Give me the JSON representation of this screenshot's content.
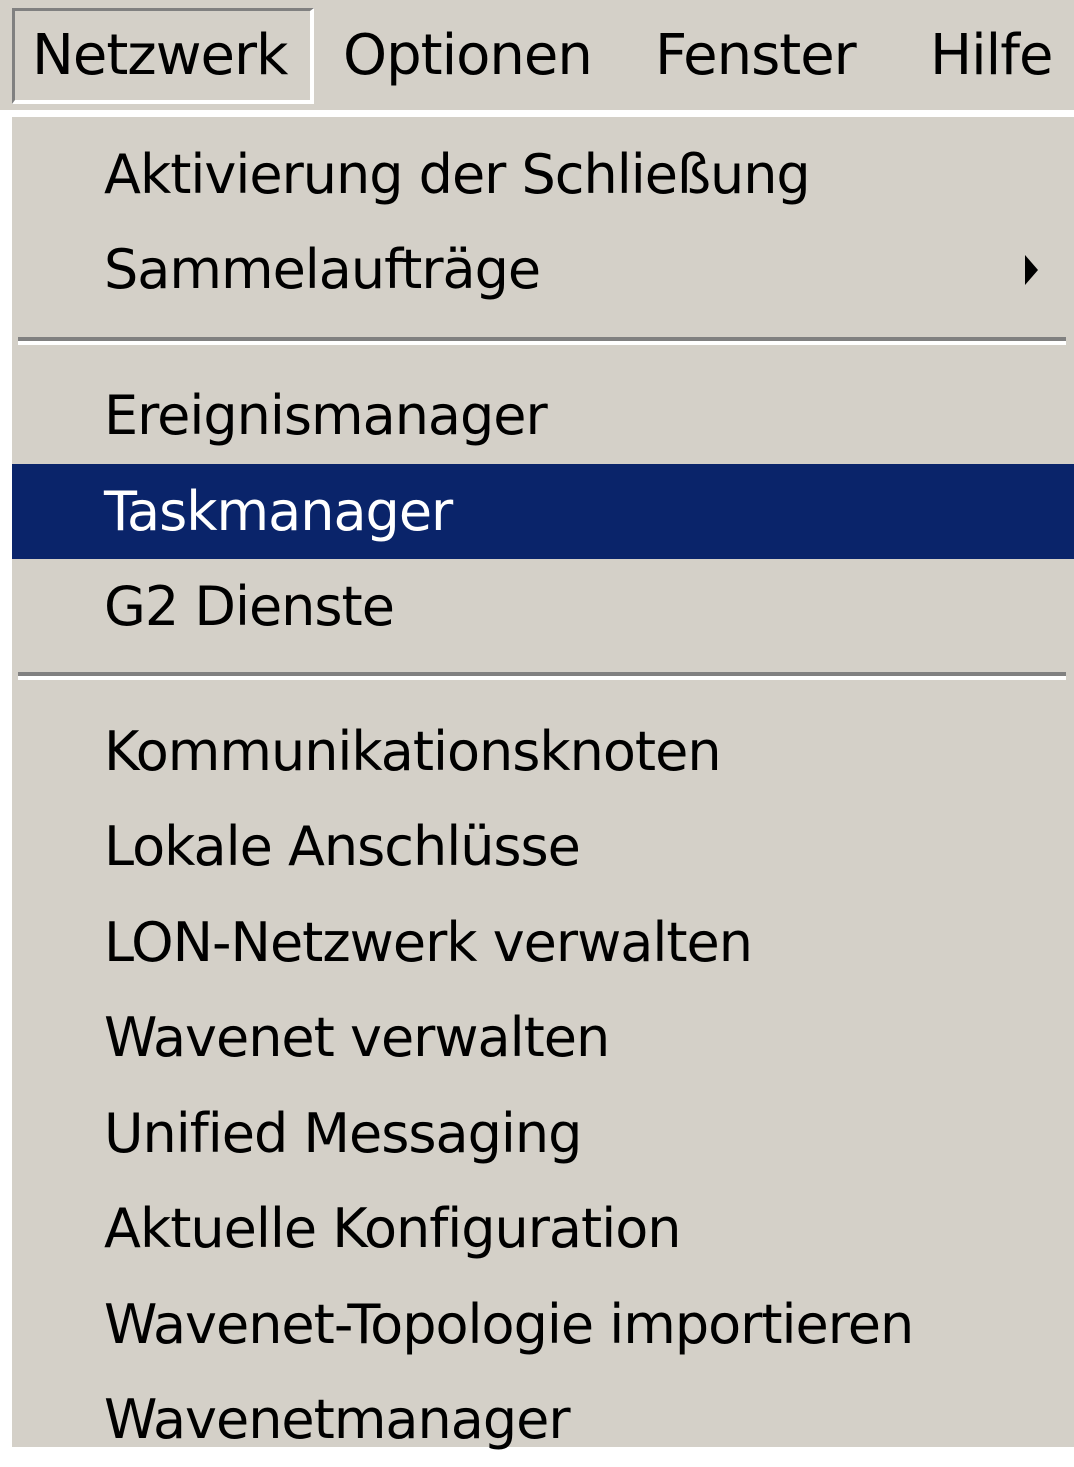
{
  "menubar": {
    "items": [
      {
        "label": "Netzwerk",
        "active": true
      },
      {
        "label": "Optionen"
      },
      {
        "label": "Fenster"
      },
      {
        "label": "Hilfe"
      }
    ]
  },
  "dropdown": {
    "items": [
      {
        "label": "Aktivierung der Schließung"
      },
      {
        "label": "Sammelaufträge",
        "has_submenu": true
      },
      {
        "label": "Ereignismanager"
      },
      {
        "label": "Taskmanager",
        "highlighted": true
      },
      {
        "label": "G2 Dienste"
      },
      {
        "label": "Kommunikationsknoten"
      },
      {
        "label": "Lokale Anschlüsse"
      },
      {
        "label": "LON-Netzwerk verwalten"
      },
      {
        "label": "Wavenet verwalten"
      },
      {
        "label": "Unified Messaging"
      },
      {
        "label": "Aktuelle Konfiguration"
      },
      {
        "label": "Wavenet-Topologie importieren"
      },
      {
        "label": "Wavenetmanager"
      }
    ]
  },
  "colors": {
    "menu_background": "#d4d0c8",
    "highlight_background": "#0a246a",
    "highlight_text": "#ffffff",
    "text": "#000000"
  },
  "icons": {
    "submenu_indicator": "submenu-arrow-icon"
  }
}
